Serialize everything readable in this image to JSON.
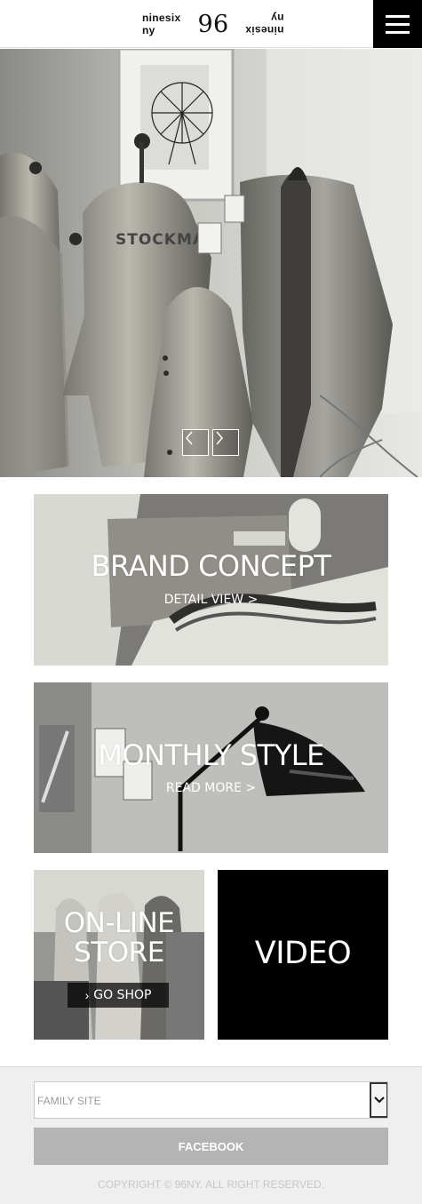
{
  "header": {
    "logo": {
      "text_left": "ninesix ny",
      "mark": "96",
      "text_right": "ninesix ny"
    },
    "menu_icon": "hamburger-menu-icon"
  },
  "hero": {
    "prev_icon": "chevron-left-icon",
    "next_icon": "chevron-right-icon",
    "mannequin_label": "STOCKMAN"
  },
  "cards": {
    "brand": {
      "title": "BRAND CONCEPT",
      "link": "DETAIL VIEW >"
    },
    "monthly": {
      "title": "MONTHLY STYLE",
      "link": "READ MORE >"
    },
    "store": {
      "title_line1": "ON-LINE",
      "title_line2": "STORE",
      "link_icon": "›",
      "link": "GO SHOP"
    },
    "video": {
      "title": "VIDEO"
    }
  },
  "footer": {
    "family_site": {
      "selected": "FAMILY SITE",
      "icon": "chevron-down-icon"
    },
    "facebook": "FACEBOOK",
    "copyright": "COPYRIGHT © 96NY. ALL RIGHT RESERVED."
  }
}
